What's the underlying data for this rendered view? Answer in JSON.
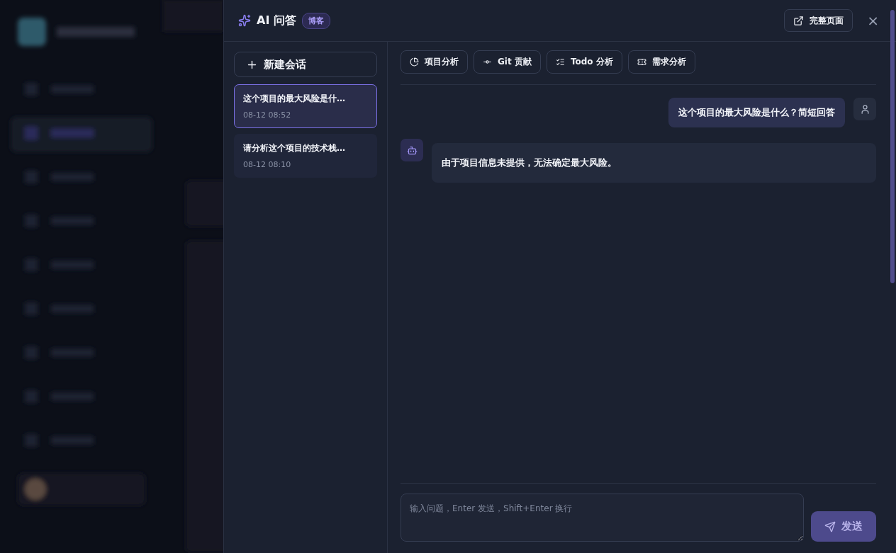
{
  "panel": {
    "title": "AI 问答",
    "badge": "博客",
    "full_page_button": "完整页面",
    "close": "×"
  },
  "sessions": {
    "new_button": "新建会话",
    "items": [
      {
        "title": "这个项目的最大风险是什…",
        "time": "08-12 08:52",
        "selected": true
      },
      {
        "title": "请分析这个项目的技术栈…",
        "time": "08-12 08:10",
        "selected": false
      }
    ]
  },
  "quick_actions": [
    {
      "kind": "pie",
      "label": "项目分析"
    },
    {
      "kind": "commit",
      "label": "Git 贡献"
    },
    {
      "kind": "list",
      "label": "Todo 分析"
    },
    {
      "kind": "ticket",
      "label": "需求分析"
    }
  ],
  "messages": [
    {
      "kind": "user",
      "text": "这个项目的最大风险是什么？简短回答"
    },
    {
      "kind": "assistant",
      "text": "由于项目信息未提供，无法确定最大风险。"
    }
  ],
  "composer": {
    "placeholder": "输入问题，Enter 发送，Shift+Enter 换行",
    "send_button": "发送"
  }
}
